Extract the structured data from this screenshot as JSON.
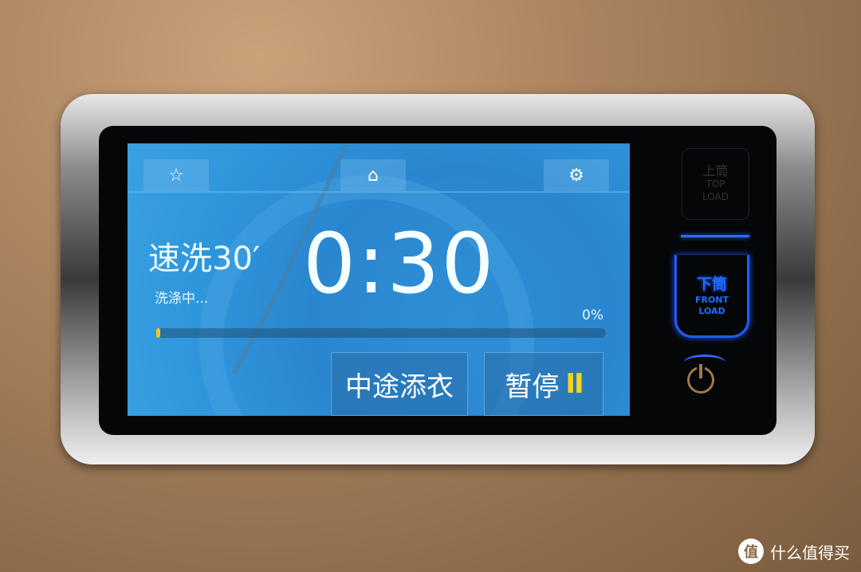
{
  "screen": {
    "tabs": [
      {
        "icon": "star-icon",
        "glyph": "☆"
      },
      {
        "icon": "home-icon",
        "glyph": "⌂"
      },
      {
        "icon": "gear-icon",
        "glyph": "⚙"
      }
    ],
    "program_name": "速洗30′",
    "status": "洗涤中...",
    "remaining_time": "0:30",
    "progress_percent_label": "0%",
    "progress_percent": 0,
    "add_clothes_button": "中途添衣",
    "pause_button": "暂停",
    "pause_icon_glyph": "II"
  },
  "side_panel": {
    "top_load_cn": "上筒",
    "top_load_en1": "TOP",
    "top_load_en2": "LOAD",
    "front_load_cn": "下筒",
    "front_load_en1": "FRONT",
    "front_load_en2": "LOAD"
  },
  "watermark": {
    "logo": "值",
    "text": "什么值得买"
  },
  "colors": {
    "accent_blue": "#1f6bff",
    "progress": "#f2c322",
    "screen": "#2a86cf"
  }
}
